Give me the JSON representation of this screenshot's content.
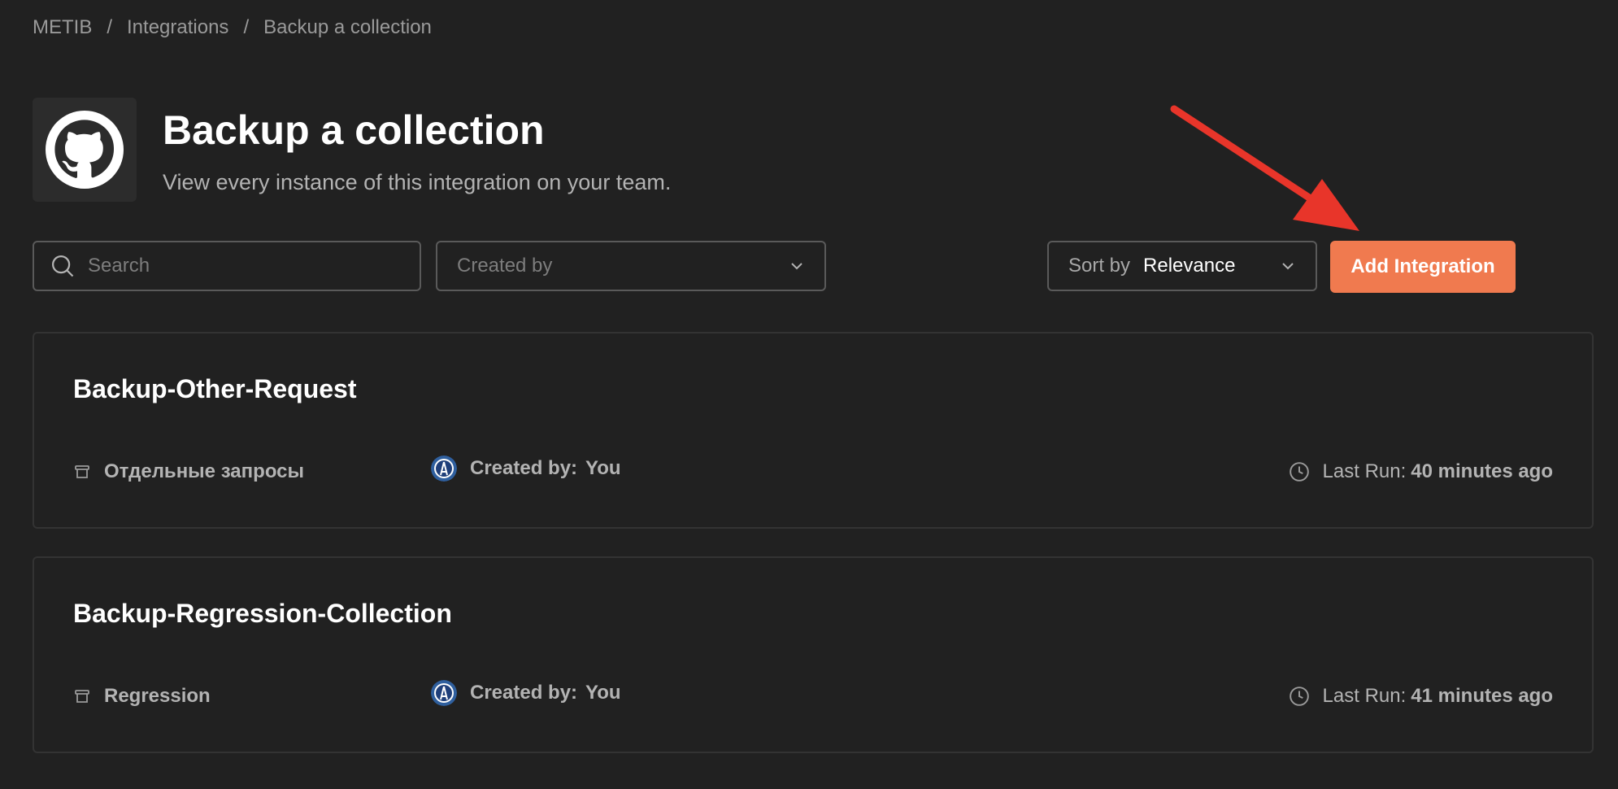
{
  "breadcrumb": {
    "items": [
      "METIB",
      "Integrations",
      "Backup a collection"
    ],
    "separator": "/"
  },
  "header": {
    "icon": "github-icon",
    "title": "Backup a collection",
    "subtitle": "View every instance of this integration on your team."
  },
  "toolbar": {
    "search_placeholder": "Search",
    "created_by_placeholder": "Created by",
    "sort_label": "Sort by",
    "sort_value": "Relevance",
    "add_button_label": "Add Integration"
  },
  "annotation": {
    "arrow_color": "#e8352a"
  },
  "colors": {
    "background": "#212121",
    "accent": "#f07a4f",
    "border": "#5a5a5a"
  },
  "integrations": [
    {
      "name": "Backup-Other-Request",
      "collection": "Отдельные запросы",
      "created_by_label": "Created by:",
      "created_by_value": "You",
      "last_run_label": "Last Run:",
      "last_run_value": "40 minutes ago"
    },
    {
      "name": "Backup-Regression-Collection",
      "collection": "Regression",
      "created_by_label": "Created by:",
      "created_by_value": "You",
      "last_run_label": "Last Run:",
      "last_run_value": "41 minutes ago"
    }
  ]
}
